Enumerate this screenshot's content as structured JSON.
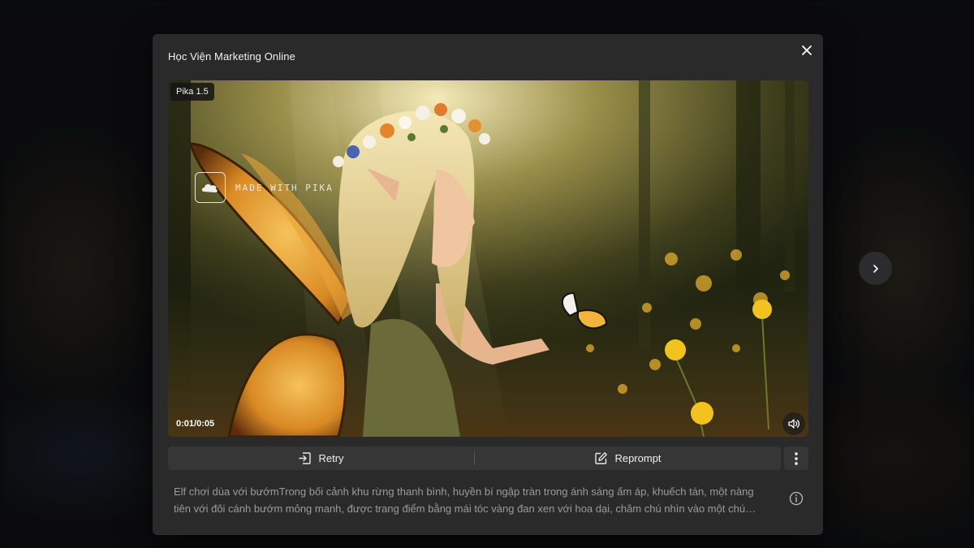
{
  "modal": {
    "title": "Học Viện Marketing Online",
    "close_icon": "close-icon"
  },
  "video": {
    "model_badge": "Pika 1.5",
    "watermark_text": "MADE WITH PIKA",
    "time_readout": "0:01/0:05",
    "volume_icon": "volume-icon",
    "progress": 0.2
  },
  "actions": {
    "retry_label": "Retry",
    "retry_icon": "retry-icon",
    "reprompt_label": "Reprompt",
    "reprompt_icon": "edit-icon",
    "more_icon": "more-vertical-icon"
  },
  "prompt": {
    "text": "Elf chơi dùa với bướmTrong bối cảnh khu rừng thanh bình, huyền bí ngập tràn trong ánh sáng ấm áp, khuếch tán, một nàng tiên với đôi cánh bướm mỏng manh, được trang điểm bằng mái tóc vàng đan xen với hoa dại, chăm chú nhìn vào một chú bướm nhỏ đậu trên tay.",
    "info_icon": "info-icon"
  },
  "navigation": {
    "next_icon": "chevron-right-icon"
  },
  "colors": {
    "modal_bg": "#2a2a2b",
    "button_bg": "#363637",
    "page_bg": "#111214"
  }
}
